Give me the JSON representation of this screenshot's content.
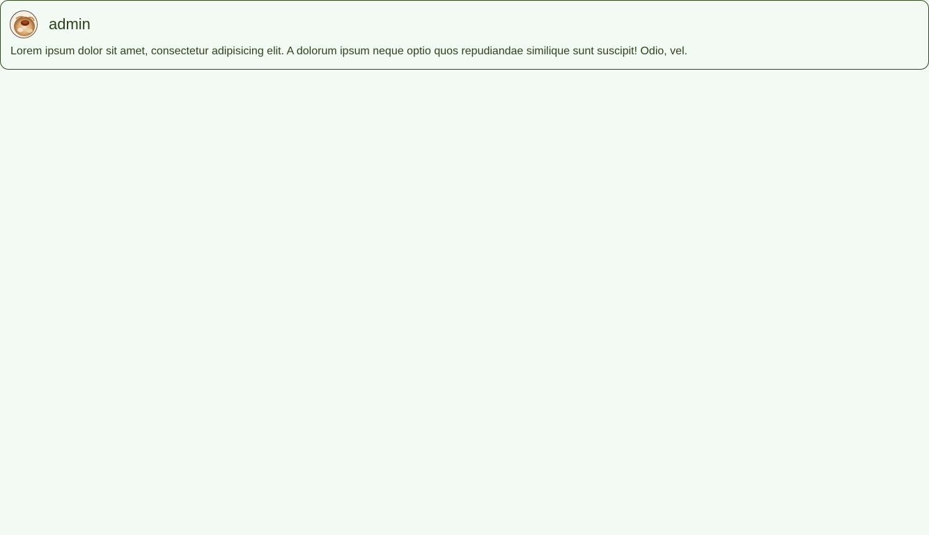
{
  "post": {
    "author": {
      "name": "admin",
      "avatar_icon": "user-avatar"
    },
    "body": "Lorem ipsum dolor sit amet, consectetur adipisicing elit. A dolorum ipsum neque optio quos repudiandae similique sunt suscipit! Odio, vel."
  },
  "colors": {
    "background": "#f3faf3",
    "border": "#2f4a1f",
    "text": "#2d4219"
  }
}
